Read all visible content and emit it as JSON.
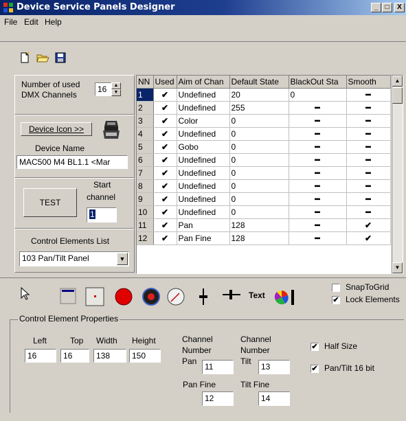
{
  "window": {
    "title": "Device Service Panels Designer",
    "buttons": [
      "_",
      "□",
      "X"
    ]
  },
  "menu": [
    "File",
    "Edit",
    "Help"
  ],
  "toolbar": {
    "icons": [
      "new-file-icon",
      "open-folder-icon",
      "save-disk-icon"
    ]
  },
  "left_panel": {
    "num_channels_label_1": "Number of used",
    "num_channels_label_2": "DMX Channels",
    "num_channels_value": "16",
    "device_icon_button": "Device Icon >>",
    "device_name_label": "Device Name",
    "device_name_value": "MAC500 M4 BL1.1 <Mar",
    "test_button": "TEST",
    "start_channel_label_1": "Start",
    "start_channel_label_2": "channel",
    "start_channel_value": "1",
    "control_list_label": "Control Elements List",
    "control_list_value": "103 Pan/Tilt Panel"
  },
  "grid": {
    "headers": [
      "NN",
      "Used",
      "Aim of Chan",
      "Default State",
      "BlackOut Sta",
      "Smooth"
    ],
    "check_symbol": "✔",
    "dash_symbol": "━",
    "rows": [
      {
        "nn": "1",
        "used": true,
        "aim": "Undefined",
        "default": "20",
        "blackout": "0",
        "smooth": "-",
        "selected": true
      },
      {
        "nn": "2",
        "used": true,
        "aim": "Undefined",
        "default": "255",
        "blackout": "-",
        "smooth": "-"
      },
      {
        "nn": "3",
        "used": true,
        "aim": "Color",
        "default": "0",
        "blackout": "-",
        "smooth": "-"
      },
      {
        "nn": "4",
        "used": true,
        "aim": "Undefined",
        "default": "0",
        "blackout": "-",
        "smooth": "-"
      },
      {
        "nn": "5",
        "used": true,
        "aim": "Gobo",
        "default": "0",
        "blackout": "-",
        "smooth": "-"
      },
      {
        "nn": "6",
        "used": true,
        "aim": "Undefined",
        "default": "0",
        "blackout": "-",
        "smooth": "-"
      },
      {
        "nn": "7",
        "used": true,
        "aim": "Undefined",
        "default": "0",
        "blackout": "-",
        "smooth": "-"
      },
      {
        "nn": "8",
        "used": true,
        "aim": "Undefined",
        "default": "0",
        "blackout": "-",
        "smooth": "-"
      },
      {
        "nn": "9",
        "used": true,
        "aim": "Undefined",
        "default": "0",
        "blackout": "-",
        "smooth": "-"
      },
      {
        "nn": "10",
        "used": true,
        "aim": "Undefined",
        "default": "0",
        "blackout": "-",
        "smooth": "-"
      },
      {
        "nn": "11",
        "used": true,
        "aim": "Pan",
        "default": "128",
        "blackout": "-",
        "smooth": "check"
      },
      {
        "nn": "12",
        "used": true,
        "aim": "Pan Fine",
        "default": "128",
        "blackout": "-",
        "smooth": "check"
      }
    ]
  },
  "palette": {
    "tools": [
      "pointer-icon",
      "blank-panel-icon",
      "point-icon",
      "red-button-icon",
      "black-knob-icon",
      "dial-icon",
      "vertical-fader-icon",
      "horizontal-fader-icon",
      "text-tool-icon",
      "color-wheel-icon"
    ],
    "text_tool_label": "Text",
    "snap_to_grid_label": "SnapToGrid",
    "snap_to_grid_checked": false,
    "lock_elements_label": "Lock Elements",
    "lock_elements_checked": true
  },
  "properties": {
    "group_title": "Control Element Properties",
    "left_label": "Left",
    "left_value": "16",
    "top_label": "Top",
    "top_value": "16",
    "width_label": "Width",
    "width_value": "138",
    "height_label": "Height",
    "height_value": "150",
    "ch_number_label_1": "Channel",
    "ch_number_label_2": "Number",
    "pan_label": "Pan",
    "pan_value": "11",
    "tilt_label": "Tilt",
    "tilt_value": "13",
    "pan_fine_label": "Pan Fine",
    "pan_fine_value": "12",
    "tilt_fine_label": "Tilt Fine",
    "tilt_fine_value": "14",
    "half_size_label": "Half Size",
    "half_size_checked": true,
    "pan_tilt_16bit_label": "Pan/Tilt 16 bit",
    "pan_tilt_16bit_checked": true
  }
}
